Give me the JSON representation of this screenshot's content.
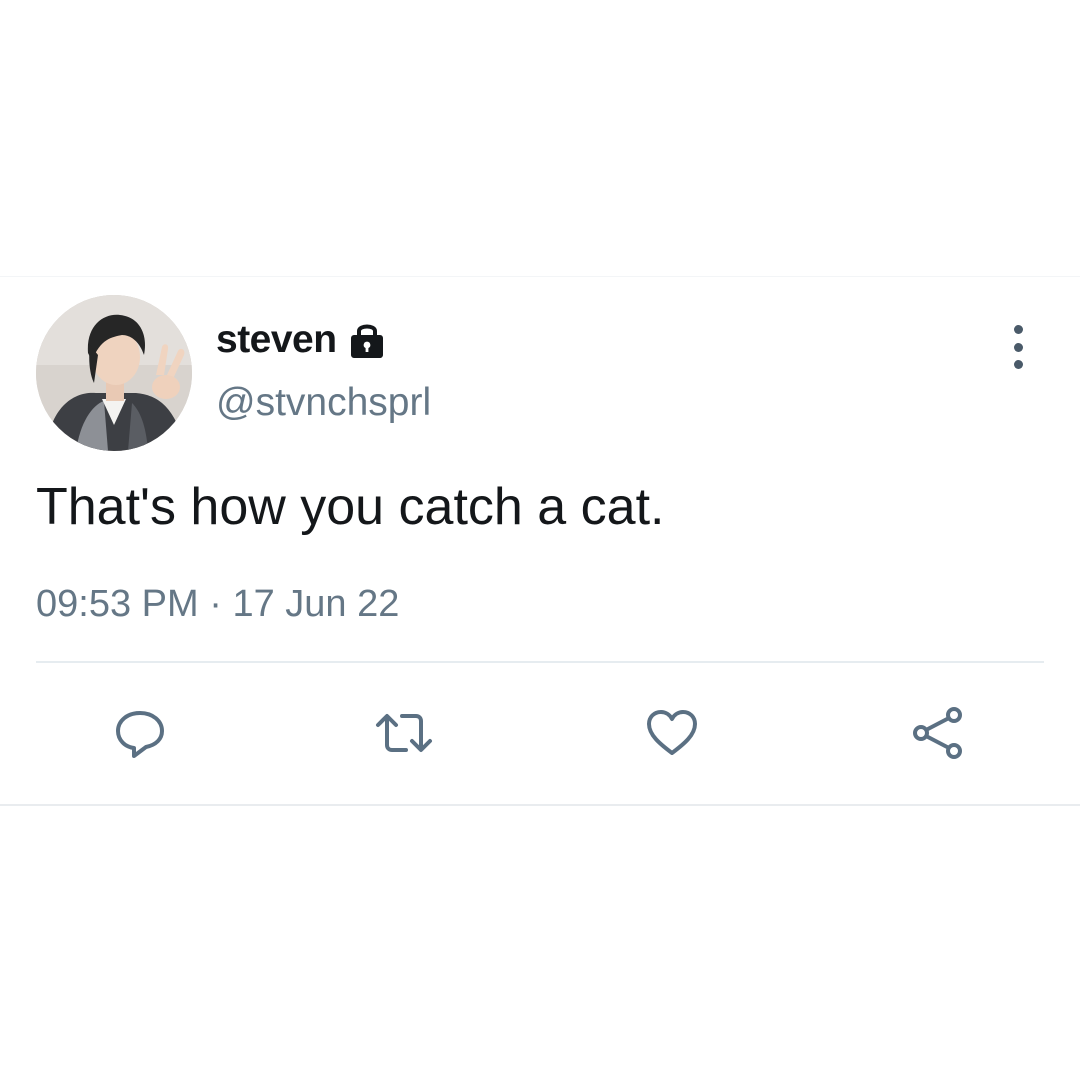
{
  "tweet": {
    "display_name": "steven",
    "handle": "@stvnchsprl",
    "text": "That's how you catch a cat.",
    "time": "09:53 PM",
    "separator": "·",
    "date": "17 Jun 22",
    "protected_icon": "lock-icon",
    "menu_icon": "more-vertical-icon"
  },
  "actions": [
    {
      "name": "reply",
      "icon": "comment-icon"
    },
    {
      "name": "retweet",
      "icon": "retweet-icon"
    },
    {
      "name": "like",
      "icon": "heart-icon"
    },
    {
      "name": "share",
      "icon": "share-icon"
    }
  ],
  "colors": {
    "text_primary": "#14171a",
    "text_secondary": "#657786",
    "icon": "#5b7083",
    "divider": "#e6ecf0",
    "background": "#ffffff"
  }
}
